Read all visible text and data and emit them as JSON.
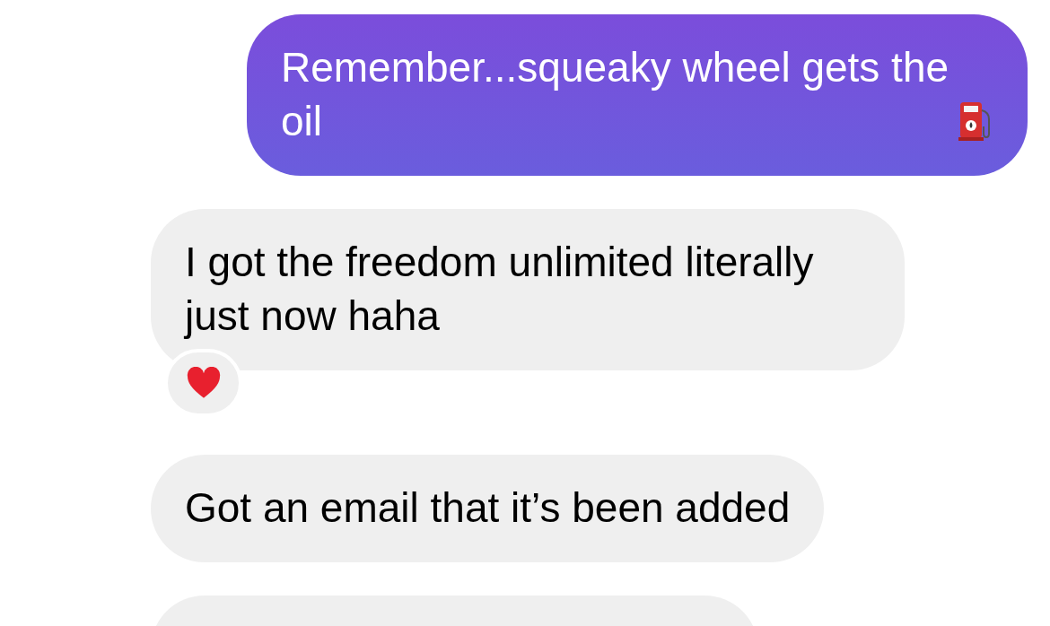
{
  "messages": [
    {
      "kind": "sent",
      "text": "Remember...squeaky wheel gets the oil",
      "ends_with_emoji": true,
      "reacted": false
    },
    {
      "kind": "received",
      "text": "I got the freedom unlimited literally just now haha",
      "ends_with_emoji": false,
      "reacted": true
    },
    {
      "kind": "received",
      "text": "Got an email that it’s been added",
      "ends_with_emoji": false,
      "reacted": false
    },
    {
      "kind": "received"
    }
  ]
}
